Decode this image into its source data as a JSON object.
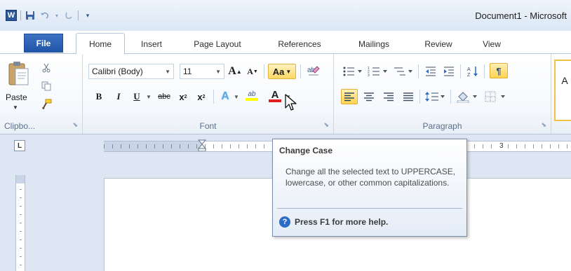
{
  "window": {
    "title": "Document1 - Microsoft"
  },
  "qat": {
    "app_icon": "W",
    "icons": [
      "word-logo-icon",
      "save-icon",
      "undo-icon",
      "redo-icon",
      "customize-icon"
    ]
  },
  "tabs": [
    {
      "label": "File"
    },
    {
      "label": "Home"
    },
    {
      "label": "Insert"
    },
    {
      "label": "Page Layout"
    },
    {
      "label": "References"
    },
    {
      "label": "Mailings"
    },
    {
      "label": "Review"
    },
    {
      "label": "View"
    }
  ],
  "clipboard": {
    "paste_label": "Paste",
    "group_label": "Clipbo..."
  },
  "font": {
    "font_name": "Calibri (Body)",
    "font_size": "11",
    "grow_label": "A",
    "shrink_label": "A",
    "change_case_label": "Aa",
    "bold": "B",
    "italic": "I",
    "underline": "U",
    "strike": "abc",
    "subscript": "x",
    "superscript": "x",
    "text_effects": "A",
    "highlight": "ab",
    "font_color": "A",
    "group_label": "Font"
  },
  "paragraph": {
    "group_label": "Paragraph",
    "show_hide": "¶"
  },
  "styles_peek": {
    "label": "A"
  },
  "ruler": {
    "number": "3"
  },
  "tooltip": {
    "title": "Change Case",
    "body": "Change all the selected text to UPPERCASE, lowercase, or other common capitalizations.",
    "help": "Press F1 for more help."
  },
  "colors": {
    "accent": "#2b5797",
    "hover": "#ffd864",
    "font_color_bar": "#e02020",
    "highlight_bar": "#ffff00"
  }
}
